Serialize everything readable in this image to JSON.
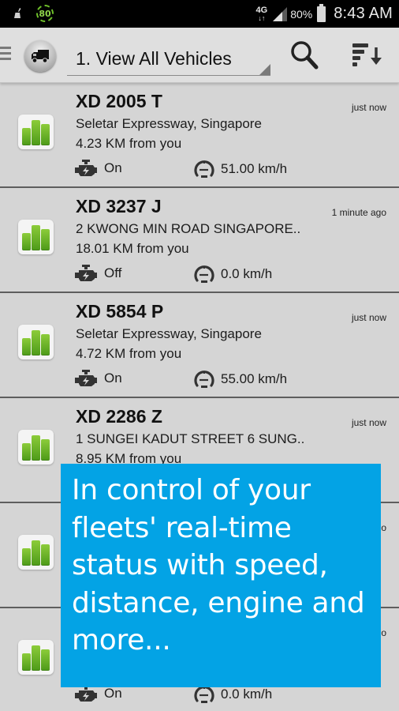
{
  "status_bar": {
    "notification_icons": [
      "cleaner-broom-icon",
      "speedometer-80-icon"
    ],
    "speed_badge": "80",
    "network_type": "4G",
    "network_arrows": "↓↑",
    "battery_percent": "80%",
    "time": "8:43 AM"
  },
  "toolbar": {
    "drawer_icon": "menu-icon",
    "app_icon": "truck-icon",
    "view_selector": {
      "selected": "1. View All Vehicles"
    },
    "actions": [
      {
        "name": "search",
        "icon": "search-icon"
      },
      {
        "name": "sort",
        "icon": "sort-icon"
      }
    ]
  },
  "vehicles": [
    {
      "plate": "XD 2005 T",
      "updated": "just now",
      "address": "Seletar Expressway, Singapore",
      "distance": "4.23 KM from you",
      "engine": "On",
      "speed": "51.00 km/h"
    },
    {
      "plate": "XD 3237 J",
      "updated": "1 minute ago",
      "address": "2 KWONG MIN ROAD SINGAPORE..",
      "distance": "18.01 KM from you",
      "engine": "Off",
      "speed": "0.0 km/h"
    },
    {
      "plate": "XD 5854 P",
      "updated": "just now",
      "address": "Seletar Expressway, Singapore",
      "distance": "4.72 KM from you",
      "engine": "On",
      "speed": "55.00 km/h"
    },
    {
      "plate": "XD 2286 Z",
      "updated": "just now",
      "address": "1 SUNGEI KADUT STREET 6 SUNG..",
      "distance": "8.95 KM from you",
      "engine": "",
      "speed": ""
    },
    {
      "plate": "",
      "updated": "o",
      "address": "",
      "distance": "",
      "engine": "",
      "speed": ""
    },
    {
      "plate": "",
      "updated": "o",
      "address": "",
      "distance": "",
      "engine": "On",
      "speed": "0.0 km/h"
    }
  ],
  "promo": {
    "text": "In control of your fleets' real-time status with speed, distance, engine and more..."
  },
  "colors": {
    "status_bar_bg": "#000000",
    "toolbar_bg": "#dfdfdf",
    "list_bg": "#d5d5d5",
    "signal_green": "#6ab82b",
    "promo_blue": "#03a3e5"
  }
}
